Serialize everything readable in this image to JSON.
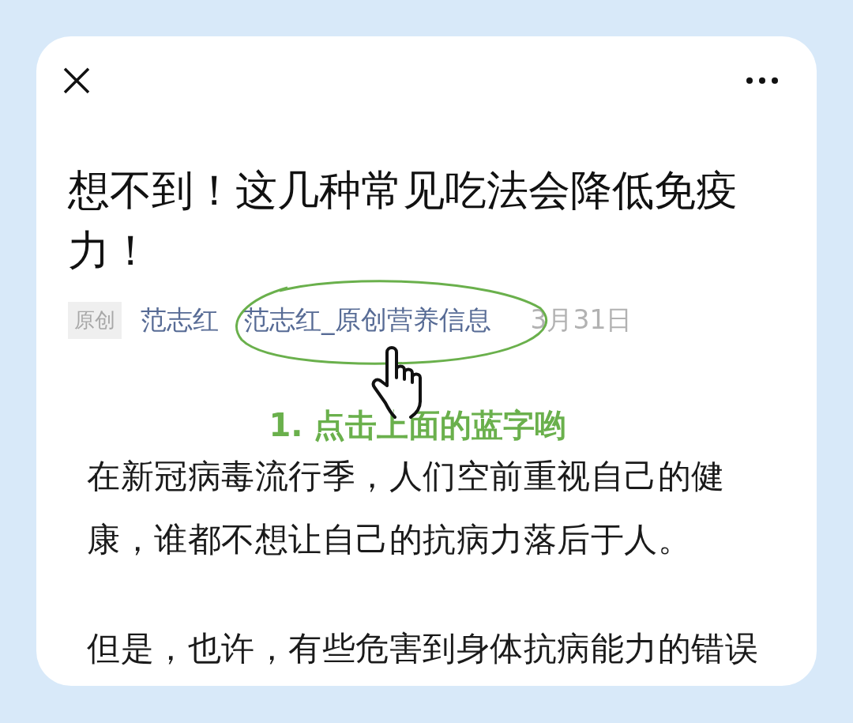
{
  "article": {
    "title": "想不到！这几种常见吃法会降低免疫力！",
    "meta": {
      "tag": "原创",
      "author": "范志红",
      "account": "范志红_原创营养信息",
      "date": "3月31日"
    },
    "annotation": "1. 点击上面的蓝字哟",
    "paragraphs": [
      "在新冠病毒流行季，人们空前重视自己的健康，谁都不想让自己的抗病力落后于人。",
      "但是，也许，有些危害到身体抗病能力的错误"
    ]
  }
}
